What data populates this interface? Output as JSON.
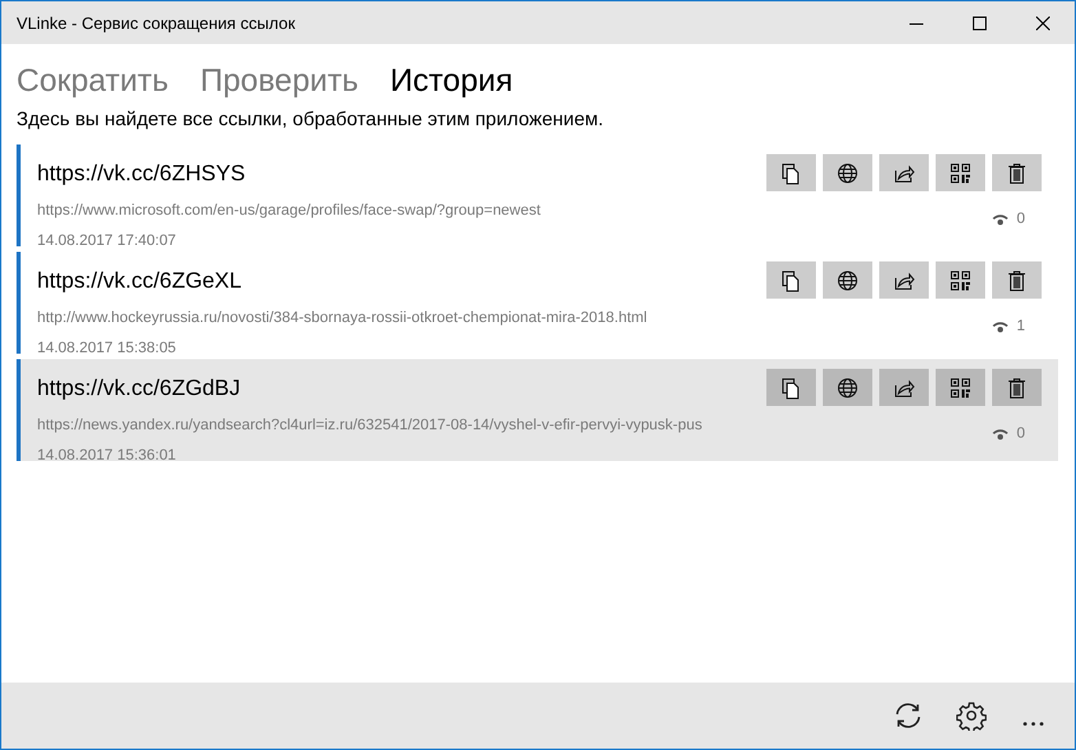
{
  "window": {
    "title": "VLinke - Сервис сокращения ссылок"
  },
  "tabs": [
    {
      "label": "Сократить",
      "selected": false
    },
    {
      "label": "Проверить",
      "selected": false
    },
    {
      "label": "История",
      "selected": true
    }
  ],
  "description": "Здесь вы найдете все ссылки, обработанные этим приложением.",
  "items": [
    {
      "short": "https://vk.cc/6ZHSYS",
      "url": "https://www.microsoft.com/en-us/garage/profiles/face-swap/?group=newest",
      "date": "14.08.2017 17:40:07",
      "views": "0",
      "selected": false
    },
    {
      "short": "https://vk.cc/6ZGeXL",
      "url": "http://www.hockeyrussia.ru/novosti/384-sbornaya-rossii-otkroet-chempionat-mira-2018.html",
      "date": "14.08.2017 15:38:05",
      "views": "1",
      "selected": false
    },
    {
      "short": "https://vk.cc/6ZGdBJ",
      "url": "https://news.yandex.ru/yandsearch?cl4url=iz.ru/632541/2017-08-14/vyshel-v-efir-pervyi-vypusk-pus",
      "date": "14.08.2017 15:36:01",
      "views": "0",
      "selected": true
    }
  ]
}
